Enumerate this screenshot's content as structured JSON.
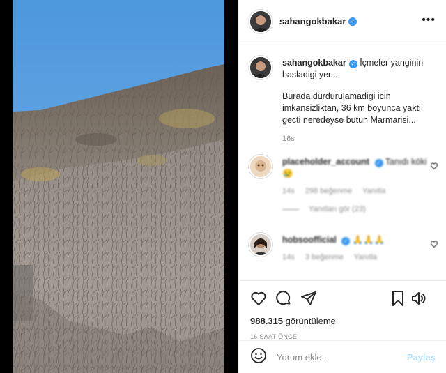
{
  "post": {
    "username": "sahangokbakar",
    "verified": true,
    "more_label": "•••",
    "caption_line1": "İçmeler yanginin basladigi yer...",
    "caption_line2": "Burada durdurulamadigi icin imkansizliktan, 36 km boyunca yakti gecti neredeyse butun Marmarisi...",
    "caption_time": "16s",
    "views_count": "988.315",
    "views_label": "görüntüleme",
    "timestamp": "16 SAAT ÖNCE"
  },
  "comments": [
    {
      "username": "placeholder_account",
      "text": "Tanıdı köki 😢",
      "meta": [
        "14s",
        "298 beğenme",
        "Yanıtla"
      ],
      "replies": "Yanıtları gör (23)"
    },
    {
      "username": "hobsoofficial",
      "text": "🙏🙏🙏",
      "meta": [
        "14s",
        "3 beğenme",
        "Yanıtla"
      ]
    }
  ],
  "add_comment": {
    "placeholder": "Yorum ekle...",
    "post_label": "Paylaş"
  },
  "icons": [
    "emoji-icon",
    "heart-icon",
    "comment-icon",
    "share-icon",
    "bookmark-icon",
    "volume-icon",
    "more-icon"
  ],
  "colors": {
    "verified": "#3897f0",
    "secondary_text": "#8e8e8e",
    "post_button": "#b2dffc",
    "sky": "#5fa5e0"
  }
}
